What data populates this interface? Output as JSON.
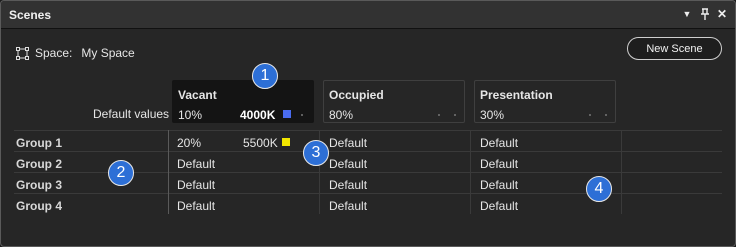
{
  "window": {
    "title": "Scenes"
  },
  "controls": {
    "menu": "▼",
    "pin": "⊥",
    "close": "✕"
  },
  "space": {
    "label": "Space:",
    "name": "My Space"
  },
  "new_scene_label": "New Scene",
  "default_values_label": "Default values",
  "scenes": [
    {
      "name": "Vacant",
      "value": "10%",
      "kelvin": "4000K",
      "swatch_color": "#4a6cf0"
    },
    {
      "name": "Occupied",
      "value": "80%"
    },
    {
      "name": "Presentation",
      "value": "30%"
    }
  ],
  "groups": [
    {
      "label": "Group 1",
      "cells": [
        "20%",
        "Default",
        "Default"
      ],
      "kelvin": "5500K",
      "swatch_color": "#f2e600"
    },
    {
      "label": "Group 2",
      "cells": [
        "Default",
        "Default",
        "Default"
      ]
    },
    {
      "label": "Group 3",
      "cells": [
        "Default",
        "Default",
        "Default"
      ]
    },
    {
      "label": "Group 4",
      "cells": [
        "Default",
        "Default",
        "Default"
      ]
    }
  ],
  "callouts": [
    "1",
    "2",
    "3",
    "4"
  ],
  "colors": {
    "callout": "#2d6fd6",
    "background": "#262626",
    "active_card": "#141414"
  }
}
